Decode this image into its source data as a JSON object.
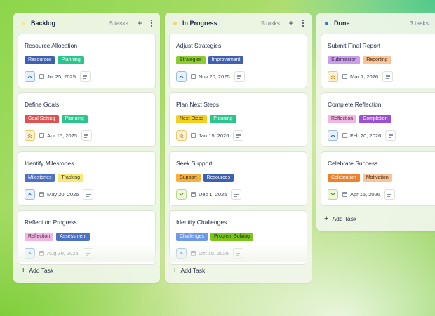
{
  "columns": [
    {
      "title": "Backlog",
      "count": "5 tasks",
      "dot_color": "#f0e6a0",
      "add_label": "Add Task",
      "cards": [
        {
          "title": "Resource Allocation",
          "tags": [
            {
              "label": "Resources",
              "bg": "#3f5fb0",
              "fg": "#ffffff"
            },
            {
              "label": "Planning",
              "bg": "#2bc48f",
              "fg": "#ffffff"
            }
          ],
          "priority": "up",
          "date": "Jul 25, 2025"
        },
        {
          "title": "Define Goals",
          "tags": [
            {
              "label": "Goal Setting",
              "bg": "#e05252",
              "fg": "#ffffff"
            },
            {
              "label": "Planning",
              "bg": "#2bc48f",
              "fg": "#ffffff"
            }
          ],
          "priority": "double-up",
          "date": "Apr 15, 2025"
        },
        {
          "title": "Identify Milestones",
          "tags": [
            {
              "label": "Milestones",
              "bg": "#4d72c4",
              "fg": "#ffffff"
            },
            {
              "label": "Tracking",
              "bg": "#f7e87a",
              "fg": "#3a3a1a"
            }
          ],
          "priority": "up",
          "date": "May 20, 2025"
        },
        {
          "title": "Reflect on Progress",
          "tags": [
            {
              "label": "Reflection",
              "bg": "#f2b6e4",
              "fg": "#4a2a44"
            },
            {
              "label": "Assessment",
              "bg": "#4d72c4",
              "fg": "#ffffff"
            }
          ],
          "priority": "up",
          "date": "Aug 30, 2025"
        }
      ]
    },
    {
      "title": "In Progress",
      "count": "5 tasks",
      "dot_color": "#f5d66a",
      "add_label": "Add Task",
      "cards": [
        {
          "title": "Adjust Strategies",
          "tags": [
            {
              "label": "Strategies",
              "bg": "#8ccc2e",
              "fg": "#1f3a08"
            },
            {
              "label": "Improvement",
              "bg": "#3f5fb0",
              "fg": "#ffffff"
            }
          ],
          "priority": "up",
          "date": "Nov 20, 2025"
        },
        {
          "title": "Plan Next Steps",
          "tags": [
            {
              "label": "Next Steps",
              "bg": "#f5d020",
              "fg": "#3a3208"
            },
            {
              "label": "Planning",
              "bg": "#2bc48f",
              "fg": "#ffffff"
            }
          ],
          "priority": "double-up",
          "date": "Jan 15, 2026"
        },
        {
          "title": "Seek Support",
          "tags": [
            {
              "label": "Support",
              "bg": "#f5b040",
              "fg": "#3a2608"
            },
            {
              "label": "Resources",
              "bg": "#3f5fb0",
              "fg": "#ffffff"
            }
          ],
          "priority": "down",
          "date": "Dec 1, 2025"
        },
        {
          "title": "Identify Challenges",
          "tags": [
            {
              "label": "Challenges",
              "bg": "#6d9ae6",
              "fg": "#ffffff"
            },
            {
              "label": "Problem Solving",
              "bg": "#7cc41c",
              "fg": "#1f3a08"
            }
          ],
          "priority": "up",
          "date": "Oct 15, 2025"
        }
      ]
    },
    {
      "title": "Done",
      "count": "3 tasks",
      "dot_color": "#3f6fd8",
      "add_label": "Add Task",
      "cards": [
        {
          "title": "Submit Final Report",
          "tags": [
            {
              "label": "Submission",
              "bg": "#c9a0e8",
              "fg": "#3a2250"
            },
            {
              "label": "Reporting",
              "bg": "#f8c49a",
              "fg": "#4a2a10"
            }
          ],
          "priority": "double-up",
          "date": "Mar 1, 2026"
        },
        {
          "title": "Complete Reflection",
          "tags": [
            {
              "label": "Reflection",
              "bg": "#f2b6e4",
              "fg": "#4a2a44"
            },
            {
              "label": "Completion",
              "bg": "#9c4fd4",
              "fg": "#ffffff"
            }
          ],
          "priority": "up",
          "date": "Feb 20, 2026"
        },
        {
          "title": "Celebrate Success",
          "tags": [
            {
              "label": "Celebration",
              "bg": "#f0802a",
              "fg": "#ffffff"
            },
            {
              "label": "Motivation",
              "bg": "#f8c49a",
              "fg": "#4a2a10"
            }
          ],
          "priority": "down",
          "date": "Apr 15, 2026"
        }
      ]
    }
  ]
}
